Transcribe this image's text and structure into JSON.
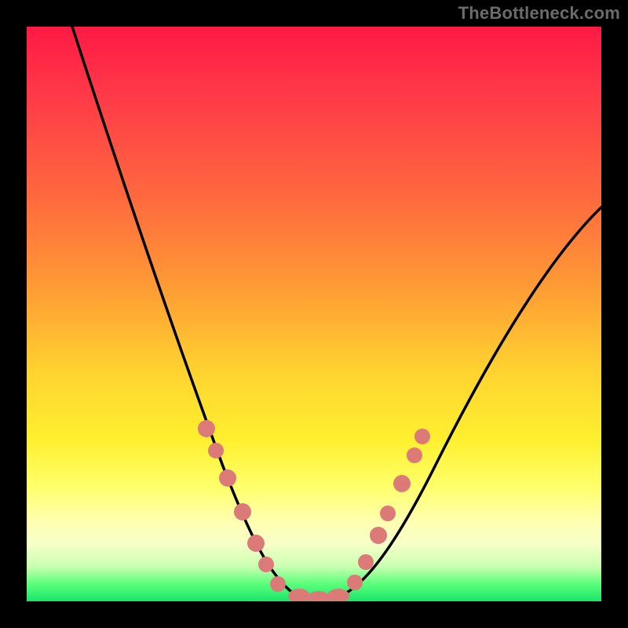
{
  "attribution": "TheBottleneck.com",
  "chart_data": {
    "type": "line",
    "title": "",
    "xlabel": "",
    "ylabel": "",
    "xlim": [
      0,
      100
    ],
    "ylim": [
      0,
      100
    ],
    "series": [
      {
        "name": "bottleneck-curve",
        "x": [
          8,
          12,
          17,
          21,
          25,
          29,
          32,
          35,
          38,
          40,
          42,
          44,
          46,
          48,
          50,
          52,
          55,
          58,
          62,
          66,
          72,
          80,
          90,
          100
        ],
        "y": [
          100,
          89,
          78,
          68,
          58,
          49,
          41,
          34,
          27,
          22,
          15,
          9,
          4,
          1,
          0,
          0,
          1,
          5,
          12,
          20,
          30,
          42,
          56,
          68
        ]
      }
    ],
    "markers": {
      "name": "highlighted-points",
      "color": "#e57373",
      "x": [
        31,
        33,
        35,
        38,
        40,
        43,
        45,
        47,
        49,
        51,
        53,
        55,
        57,
        59,
        61
      ],
      "y": [
        40,
        34,
        28,
        22,
        16,
        9,
        3,
        1,
        0,
        0,
        1,
        4,
        10,
        18,
        28
      ]
    },
    "gradient_stops": [
      {
        "pos": 0.0,
        "color": "#ff1a44"
      },
      {
        "pos": 0.5,
        "color": "#ffc431"
      },
      {
        "pos": 0.8,
        "color": "#ffff70"
      },
      {
        "pos": 0.95,
        "color": "#aaff9a"
      },
      {
        "pos": 1.0,
        "color": "#18e56a"
      }
    ]
  }
}
